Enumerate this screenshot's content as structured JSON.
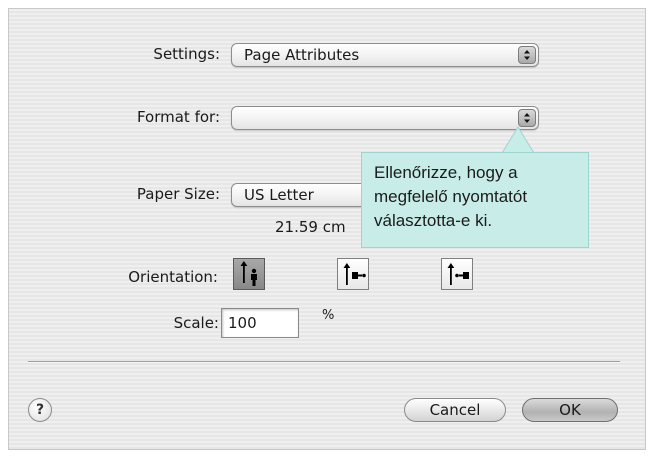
{
  "settings": {
    "label": "Settings:",
    "value": "Page Attributes"
  },
  "format_for": {
    "label": "Format for:",
    "value": ""
  },
  "paper_size": {
    "label": "Paper Size:",
    "value": "US Letter",
    "dimensions": "21.59 cm"
  },
  "orientation": {
    "label": "Orientation:",
    "options": [
      {
        "name": "portrait",
        "icon": "portrait-orientation-icon",
        "selected": true
      },
      {
        "name": "landscape",
        "icon": "landscape-orientation-icon",
        "selected": false
      },
      {
        "name": "reverse-landscape",
        "icon": "reverse-landscape-orientation-icon",
        "selected": false
      }
    ]
  },
  "scale": {
    "label": "Scale:",
    "value": "100",
    "unit": "%"
  },
  "buttons": {
    "help": "?",
    "cancel": "Cancel",
    "ok": "OK"
  },
  "callout": {
    "lines": [
      "Ellenőrizze, hogy a",
      "megfelelő nyomtatót",
      "választotta-e ki."
    ]
  },
  "colors": {
    "callout_bg": "#c8ece8",
    "dialog_bg": "#ececec"
  }
}
